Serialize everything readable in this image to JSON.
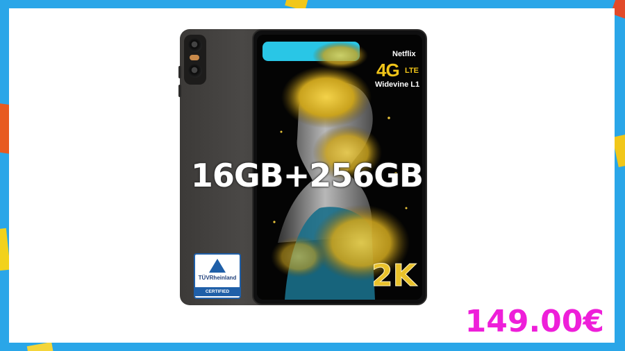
{
  "product": {
    "spec_text": "16GB+256GB",
    "price": "149.00€",
    "features": {
      "netflix": "Netflix",
      "network_main": "4G",
      "network_sub": "LTE",
      "widevine": "Widevine L1",
      "resolution": "2K"
    },
    "certification": {
      "brand": "TÜVRheinland",
      "label": "CERTIFIED"
    }
  },
  "colors": {
    "border": "#2aa6e8",
    "price": "#ee1fd9",
    "accent_gold": "#e9c12a",
    "screen_banner": "#29c6e6"
  },
  "icons": [
    "camera-icon",
    "tuv-certification-logo",
    "gold-sparkle-artwork"
  ]
}
